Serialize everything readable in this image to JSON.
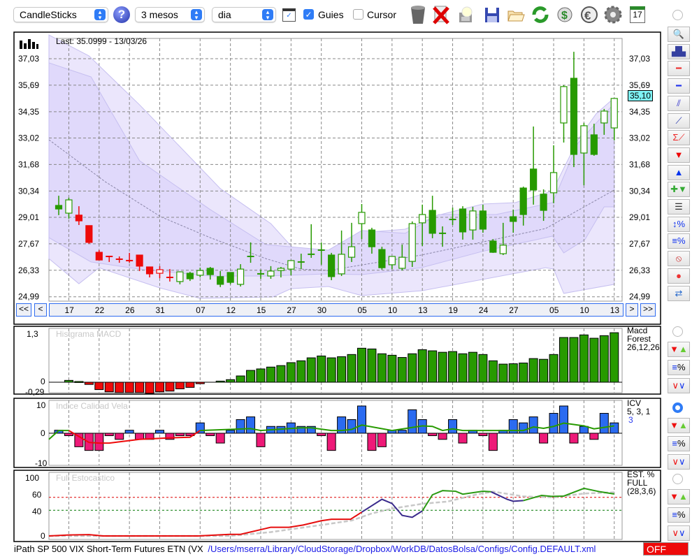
{
  "toolbar": {
    "chart_type": "CandleSticks",
    "period": "3 mesos",
    "interval": "dia",
    "guides_label": "Guies",
    "guides_checked": true,
    "cursor_label": "Cursor",
    "cursor_checked": false,
    "calendar_day": "17"
  },
  "main_chart": {
    "last_label": "Last: 35.0999 - 13/03/26",
    "last_value": "35,10",
    "y_ticks": [
      "37,03",
      "35,69",
      "34,35",
      "33,02",
      "31,68",
      "30,34",
      "29,01",
      "27,67",
      "26,33",
      "24,99"
    ],
    "y_tick_values": [
      37.03,
      35.69,
      34.35,
      33.02,
      31.68,
      30.34,
      29.01,
      27.67,
      26.33,
      24.99
    ],
    "date_ticks": [
      {
        "label": "17",
        "index": 1
      },
      {
        "label": "22",
        "index": 4
      },
      {
        "label": "26",
        "index": 7
      },
      {
        "label": "31",
        "index": 10
      },
      {
        "label": "07",
        "index": 14
      },
      {
        "label": "12",
        "index": 17
      },
      {
        "label": "15",
        "index": 20
      },
      {
        "label": "27",
        "index": 23
      },
      {
        "label": "30",
        "index": 26
      },
      {
        "label": "05",
        "index": 30
      },
      {
        "label": "10",
        "index": 33
      },
      {
        "label": "13",
        "index": 36
      },
      {
        "label": "19",
        "index": 39
      },
      {
        "label": "24",
        "index": 42
      },
      {
        "label": "27",
        "index": 45
      },
      {
        "label": "05",
        "index": 49
      },
      {
        "label": "10",
        "index": 52
      },
      {
        "label": "13",
        "index": 55
      }
    ],
    "nav": {
      "first": "<<",
      "prev": "<",
      "next": ">",
      "last": ">>"
    }
  },
  "chart_data": [
    {
      "type": "candlestick",
      "title": "CandleSticks",
      "ylim": [
        24.99,
        37.03
      ],
      "candles_ohlc_color": [
        [
          29.61,
          30.1,
          29.12,
          29.43,
          "g"
        ],
        [
          29.22,
          30.0,
          28.94,
          29.89,
          "g"
        ],
        [
          29.12,
          29.57,
          28.62,
          28.83,
          "r"
        ],
        [
          28.59,
          28.59,
          27.67,
          27.74,
          "r"
        ],
        [
          27.24,
          27.35,
          26.85,
          26.85,
          "r"
        ],
        [
          27.03,
          27.03,
          26.75,
          27.03,
          "r"
        ],
        [
          26.89,
          27.03,
          26.71,
          26.89,
          "r"
        ],
        [
          26.82,
          27.21,
          26.71,
          26.82,
          "r"
        ],
        [
          27.1,
          27.1,
          26.29,
          26.54,
          "r"
        ],
        [
          26.5,
          26.5,
          25.97,
          26.15,
          "r"
        ],
        [
          26.18,
          26.54,
          25.93,
          26.36,
          "r"
        ],
        [
          25.97,
          26.39,
          25.76,
          25.97,
          "r"
        ],
        [
          25.76,
          26.25,
          25.62,
          26.25,
          "g"
        ],
        [
          26.18,
          26.25,
          25.79,
          25.9,
          "g"
        ],
        [
          26.08,
          26.46,
          25.97,
          26.32,
          "g"
        ],
        [
          26.43,
          26.5,
          25.86,
          26.11,
          "g"
        ],
        [
          26.01,
          26.29,
          25.48,
          25.62,
          "g"
        ],
        [
          26.22,
          26.22,
          25.62,
          25.72,
          "g"
        ],
        [
          25.62,
          26.64,
          25.51,
          26.39,
          "g"
        ],
        [
          27.03,
          27.74,
          26.71,
          27.03,
          "g"
        ],
        [
          26.15,
          26.36,
          25.9,
          26.15,
          "g"
        ],
        [
          26.04,
          26.54,
          25.9,
          26.29,
          "g"
        ],
        [
          26.32,
          26.5,
          25.97,
          26.43,
          "g"
        ],
        [
          26.39,
          26.82,
          26.08,
          26.82,
          "g"
        ],
        [
          26.75,
          27.17,
          26.39,
          26.75,
          "g"
        ],
        [
          27.14,
          28.66,
          26.96,
          27.14,
          "g"
        ],
        [
          27.35,
          27.74,
          26.61,
          27.35,
          "g"
        ],
        [
          27.1,
          27.21,
          25.83,
          26.01,
          "g"
        ],
        [
          26.15,
          28.34,
          26.04,
          27.14,
          "g"
        ],
        [
          26.99,
          28.73,
          26.75,
          27.52,
          "g"
        ],
        [
          28.69,
          29.68,
          27.91,
          29.26,
          "g"
        ],
        [
          28.37,
          28.48,
          27.17,
          27.52,
          "g"
        ],
        [
          27.38,
          27.52,
          26.36,
          26.46,
          "g"
        ],
        [
          26.61,
          27.03,
          26.39,
          27.03,
          "g"
        ],
        [
          26.43,
          27.63,
          26.32,
          26.99,
          "g"
        ],
        [
          26.78,
          28.8,
          26.5,
          28.69,
          "g"
        ],
        [
          28.73,
          29.65,
          27.56,
          29.15,
          "g"
        ],
        [
          29.36,
          30.1,
          27.95,
          28.2,
          "g"
        ],
        [
          28.2,
          28.55,
          27.52,
          28.2,
          "g"
        ],
        [
          28.9,
          29.5,
          28.62,
          28.9,
          "g"
        ],
        [
          29.43,
          29.57,
          27.88,
          28.27,
          "g"
        ],
        [
          28.37,
          29.54,
          27.88,
          29.33,
          "g"
        ],
        [
          29.33,
          29.65,
          28.23,
          28.41,
          "g"
        ],
        [
          27.81,
          27.91,
          27.21,
          27.24,
          "g"
        ],
        [
          27.17,
          28.73,
          27.1,
          27.6,
          "g"
        ],
        [
          29.04,
          29.4,
          28.23,
          28.8,
          "g"
        ],
        [
          30.49,
          30.56,
          28.59,
          29.15,
          "g"
        ],
        [
          31.45,
          33.6,
          29.65,
          30.39,
          "g"
        ],
        [
          30.18,
          30.42,
          28.83,
          29.36,
          "g"
        ],
        [
          30.25,
          32.65,
          29.72,
          31.27,
          "g"
        ],
        [
          33.78,
          35.69,
          32.79,
          35.62,
          "g"
        ],
        [
          36.04,
          37.38,
          31.55,
          32.19,
          "g"
        ],
        [
          32.26,
          33.78,
          30.63,
          33.64,
          "g"
        ],
        [
          33.18,
          33.74,
          32.12,
          32.19,
          "g"
        ],
        [
          33.78,
          34.49,
          33.18,
          34.38,
          "g"
        ],
        [
          33.53,
          35.02,
          32.9,
          35.02,
          "g"
        ]
      ],
      "bands": {
        "outer_upper": [
          [
            -1,
            38.23
          ],
          [
            3,
            37.17
          ],
          [
            8,
            34.7
          ],
          [
            16,
            30.46
          ],
          [
            21,
            28.69
          ],
          [
            23.5,
            27.28
          ],
          [
            28.3,
            27.28
          ],
          [
            30,
            28.23
          ],
          [
            34.3,
            28.41
          ],
          [
            37.6,
            29.12
          ],
          [
            42,
            29.68
          ],
          [
            45.2,
            29.75
          ],
          [
            48.9,
            30.35
          ],
          [
            51.4,
            32.93
          ],
          [
            53.2,
            34.24
          ],
          [
            55,
            35.05
          ]
        ],
        "outer_lower": [
          [
            -1,
            26.92
          ],
          [
            2,
            25.65
          ],
          [
            4,
            26.46
          ],
          [
            10,
            25.44
          ],
          [
            14,
            24.91
          ],
          [
            21.2,
            24.98
          ],
          [
            23,
            25.4
          ],
          [
            26.7,
            25.51
          ],
          [
            30,
            25.05
          ],
          [
            36,
            25.3
          ],
          [
            48.2,
            26.46
          ],
          [
            49,
            26.39
          ],
          [
            50,
            25.16
          ],
          [
            55,
            25.62
          ]
        ],
        "inner_upper": [
          [
            -1,
            36.82
          ],
          [
            3.2,
            36.11
          ],
          [
            8,
            31.87
          ],
          [
            15,
            29.4
          ],
          [
            20.5,
            27.63
          ],
          [
            26.7,
            27.35
          ],
          [
            30,
            28.34
          ],
          [
            34.3,
            28.2
          ],
          [
            37.6,
            29.15
          ],
          [
            43.3,
            29.15
          ],
          [
            48.9,
            29.75
          ],
          [
            51.4,
            32.76
          ],
          [
            55,
            34.77
          ]
        ],
        "inner_lower": [
          [
            -1,
            27.98
          ],
          [
            3.2,
            26.75
          ],
          [
            8,
            26.39
          ],
          [
            15,
            26.04
          ],
          [
            20.5,
            26.04
          ],
          [
            26.7,
            26.15
          ],
          [
            30,
            26.11
          ],
          [
            35.9,
            26.46
          ],
          [
            41.9,
            27.28
          ],
          [
            48.9,
            28.06
          ],
          [
            50,
            27.21
          ],
          [
            52.1,
            27.88
          ],
          [
            54,
            29.54
          ],
          [
            55,
            29.54
          ]
        ],
        "middle": [
          [
            -1,
            32.93
          ],
          [
            4.6,
            30.81
          ],
          [
            10.1,
            29.04
          ],
          [
            15,
            27.98
          ],
          [
            20.5,
            26.92
          ],
          [
            24,
            26.39
          ],
          [
            26.7,
            26.32
          ],
          [
            35.9,
            27.1
          ],
          [
            48.2,
            28.44
          ],
          [
            55,
            30.39
          ]
        ]
      }
    },
    {
      "type": "bar",
      "title": "Histgrama MACD",
      "legend": [
        "Macd",
        "Forest",
        "26,12,26"
      ],
      "y_ticks": [
        "1,3",
        "0",
        "-0,29"
      ],
      "ylim": [
        -0.29,
        1.3
      ],
      "start_index": 1,
      "values": [
        0.05,
        0.02,
        -0.06,
        -0.2,
        -0.26,
        -0.28,
        -0.28,
        -0.28,
        -0.3,
        -0.26,
        -0.24,
        -0.18,
        -0.14,
        -0.04,
        0,
        0.03,
        0.07,
        0.17,
        0.32,
        0.36,
        0.41,
        0.45,
        0.53,
        0.58,
        0.66,
        0.71,
        0.66,
        0.69,
        0.75,
        0.92,
        0.9,
        0.77,
        0.73,
        0.67,
        0.77,
        0.88,
        0.85,
        0.81,
        0.83,
        0.77,
        0.81,
        0.75,
        0.58,
        0.49,
        0.5,
        0.52,
        0.64,
        0.62,
        0.75,
        1.21,
        1.21,
        1.28,
        1.19,
        1.26,
        1.34
      ]
    },
    {
      "type": "bar",
      "title": "Indice Calidad Vela",
      "legend": [
        "ICV",
        "5, 3, 1",
        "3"
      ],
      "y_ticks": [
        "10",
        "0",
        "-10"
      ],
      "ylim": [
        -10,
        10
      ],
      "values": [
        1.1,
        -0.8,
        -4.4,
        -5.6,
        -5.6,
        -0.8,
        -2,
        1.1,
        -2,
        -2,
        1.1,
        -2,
        -0.8,
        -0.8,
        3.8,
        -0.8,
        -3.2,
        1.1,
        5,
        6,
        -4.4,
        2.5,
        2.5,
        3.8,
        2.5,
        2.5,
        -0.8,
        -5.6,
        6,
        5,
        10,
        -5.6,
        -4.4,
        1.1,
        1.1,
        8.6,
        5,
        -0.8,
        -2,
        5,
        -3.2,
        1.1,
        -0.8,
        -5.6,
        1.1,
        5,
        3.8,
        6,
        -3.2,
        7.3,
        10,
        -3.2,
        2.5,
        -2,
        7.3,
        3.8
      ],
      "signal_line": [
        [
          -1,
          -2
        ],
        [
          0,
          1
        ],
        [
          1,
          1
        ],
        [
          3,
          -3
        ],
        [
          4,
          -3.2
        ],
        [
          5,
          -3.2
        ],
        [
          8,
          -2
        ],
        [
          11,
          -1.5
        ],
        [
          13,
          -1.3
        ],
        [
          14,
          1
        ],
        [
          19,
          1.7
        ],
        [
          20,
          1
        ],
        [
          24,
          2
        ],
        [
          25,
          2
        ],
        [
          27,
          1
        ],
        [
          28,
          1
        ],
        [
          29,
          1.4
        ],
        [
          30,
          3
        ],
        [
          33,
          1
        ],
        [
          36,
          2.7
        ],
        [
          37,
          2.5
        ],
        [
          38,
          1
        ],
        [
          39,
          1.6
        ],
        [
          40,
          1
        ],
        [
          46,
          1
        ],
        [
          47,
          2.3
        ],
        [
          48,
          1.8
        ],
        [
          49,
          2.5
        ],
        [
          50,
          3.7
        ],
        [
          52,
          2.7
        ],
        [
          53,
          1.6
        ],
        [
          55,
          2.7
        ]
      ],
      "signal_red_range": [
        1,
        13
      ]
    },
    {
      "type": "line",
      "title": "Full Estocastico",
      "legend": [
        "EST. %",
        "FULL",
        "(28,3,6)"
      ],
      "y_ticks": [
        "100",
        "60",
        "40",
        "0"
      ],
      "ylim": [
        0,
        100
      ],
      "levels": [
        60,
        40
      ],
      "k_line": [
        [
          -1,
          0
        ],
        [
          1,
          1.5
        ],
        [
          3,
          2
        ],
        [
          4.4,
          0
        ],
        [
          6,
          0
        ],
        [
          13.8,
          0
        ],
        [
          16.9,
          2.5
        ],
        [
          18,
          2.5
        ],
        [
          21,
          13.5
        ],
        [
          22.8,
          13.5
        ],
        [
          24.2,
          17
        ],
        [
          26,
          23.6
        ],
        [
          27,
          26
        ],
        [
          28.9,
          26
        ],
        [
          30,
          37
        ],
        [
          32,
          57
        ],
        [
          33,
          50.5
        ],
        [
          34,
          32
        ],
        [
          35,
          29
        ],
        [
          36,
          39
        ],
        [
          37,
          64
        ],
        [
          38,
          70.5
        ],
        [
          39.3,
          69.5
        ],
        [
          40,
          65
        ],
        [
          42,
          69.5
        ],
        [
          42.8,
          68.7
        ],
        [
          44.4,
          57
        ],
        [
          45,
          54
        ],
        [
          46,
          55
        ],
        [
          47.8,
          63
        ],
        [
          48.8,
          61.5
        ],
        [
          50,
          62
        ],
        [
          52,
          74
        ],
        [
          53.6,
          68.7
        ],
        [
          54.9,
          65.5
        ]
      ],
      "k_segments": [
        {
          "from": -1,
          "to": 30,
          "color": "#e60d0d"
        },
        {
          "from": 30,
          "to": 36,
          "color": "#3a2a8c"
        },
        {
          "from": 36,
          "to": 42.8,
          "color": "#2a9a12"
        },
        {
          "from": 42.8,
          "to": 46,
          "color": "#3a2a8c"
        },
        {
          "from": 46,
          "to": 55,
          "color": "#2a9a12"
        }
      ],
      "d_line": [
        [
          -1,
          0
        ],
        [
          17,
          0
        ],
        [
          21,
          6
        ],
        [
          26,
          17
        ],
        [
          29,
          24
        ],
        [
          31,
          35
        ],
        [
          33,
          42.5
        ],
        [
          36,
          50
        ],
        [
          38.5,
          53.5
        ],
        [
          41.5,
          65
        ],
        [
          43,
          69
        ],
        [
          46,
          61.5
        ],
        [
          49,
          60
        ],
        [
          52,
          66
        ],
        [
          55,
          68
        ]
      ]
    }
  ],
  "status": {
    "instrument": "iPath SP 500 VIX Short-Term Futures ETN (VX",
    "config_path": "/Users/mserra/Library/CloudStorage/Dropbox/WorkDB/DatosBolsa/Configs/Config.DEFAULT.xml",
    "off_label": "OFF"
  },
  "colors": {
    "green": "#279a00",
    "red": "#ee0a0a",
    "blue": "#2b6bf0",
    "pink": "#ee1a78",
    "accent": "#2f7cf6",
    "band": "#d9d0fb"
  }
}
